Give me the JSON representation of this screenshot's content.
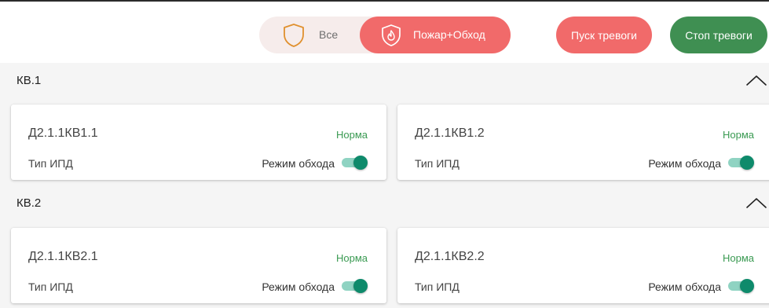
{
  "filters": {
    "all_label": "Все",
    "fire_label": "Пожар+Обход"
  },
  "actions": {
    "start_alarm": "Пуск тревоги",
    "stop_alarm": "Стоп тревоги"
  },
  "colors": {
    "alarm_red": "#f16a6a",
    "stop_green": "#3f8f52",
    "status_green": "#3a9a52",
    "toggle_on": "#0e8a6b"
  },
  "groups": [
    {
      "title": "КВ.1",
      "expanded": true,
      "devices": [
        {
          "name": "Д2.1.1КВ1.1",
          "status": "Норма",
          "type": "Тип ИПД",
          "mode_label": "Режим обхода",
          "bypass_on": true
        },
        {
          "name": "Д2.1.1КВ1.2",
          "status": "Норма",
          "type": "Тип ИПД",
          "mode_label": "Режим обхода",
          "bypass_on": true
        }
      ]
    },
    {
      "title": "КВ.2",
      "expanded": true,
      "devices": [
        {
          "name": "Д2.1.1КВ2.1",
          "status": "Норма",
          "type": "Тип ИПД",
          "mode_label": "Режим обхода",
          "bypass_on": true
        },
        {
          "name": "Д2.1.1КВ2.2",
          "status": "Норма",
          "type": "Тип ИПД",
          "mode_label": "Режим обхода",
          "bypass_on": true
        }
      ]
    }
  ]
}
